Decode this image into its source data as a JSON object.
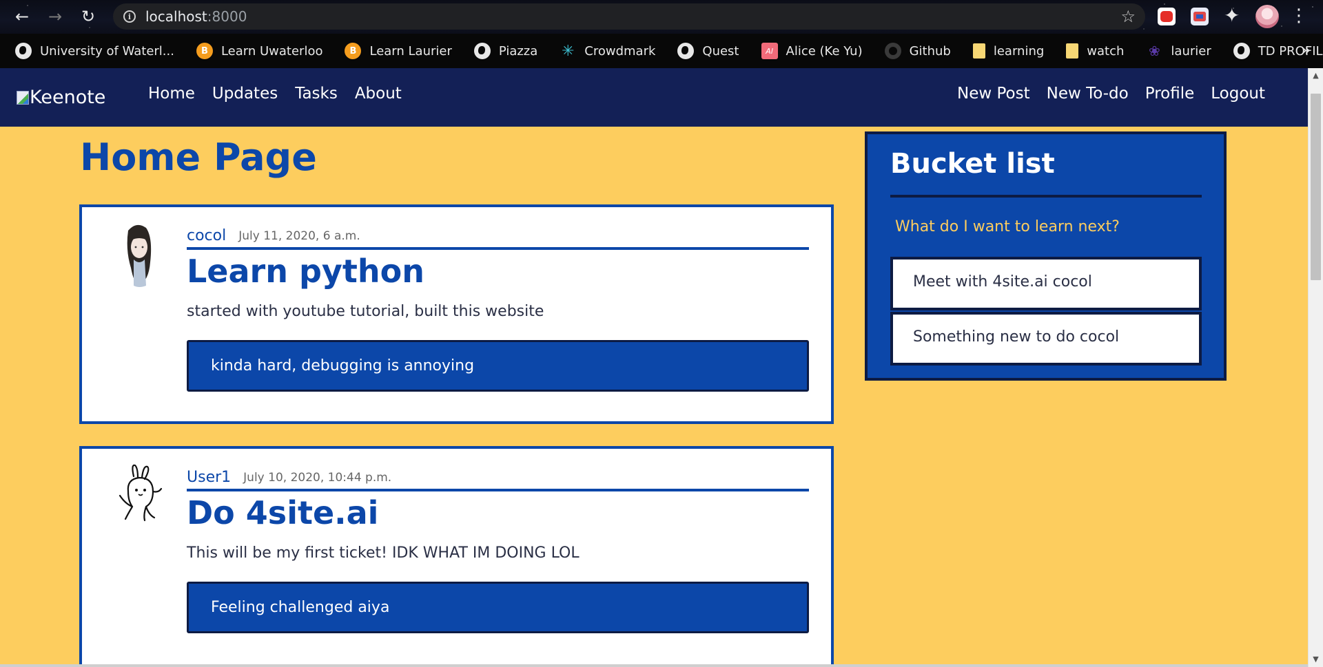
{
  "browser": {
    "url_host": "localhost",
    "url_port": ":8000",
    "bookmarks": [
      {
        "label": "University of Waterl...",
        "icon": "globe-icon"
      },
      {
        "label": "Learn Uwaterloo",
        "icon": "d2l-icon"
      },
      {
        "label": "Learn Laurier",
        "icon": "d2l-icon"
      },
      {
        "label": "Piazza",
        "icon": "globe-icon"
      },
      {
        "label": "Crowdmark",
        "icon": "crowdmark-icon"
      },
      {
        "label": "Quest",
        "icon": "globe-icon"
      },
      {
        "label": "Alice (Ke Yu)",
        "icon": "alice-icon"
      },
      {
        "label": "Github",
        "icon": "github-icon"
      },
      {
        "label": "learning",
        "icon": "folder-icon"
      },
      {
        "label": "watch",
        "icon": "folder-icon"
      },
      {
        "label": "laurier",
        "icon": "maple-leaf-icon"
      },
      {
        "label": "TD PROFILE",
        "icon": "globe-icon"
      }
    ]
  },
  "site": {
    "brand": "Keenote",
    "nav_left": [
      "Home",
      "Updates",
      "Tasks",
      "About"
    ],
    "nav_right": [
      "New Post",
      "New To-do",
      "Profile",
      "Logout"
    ]
  },
  "page": {
    "title": "Home Page"
  },
  "posts": [
    {
      "author": "cocol",
      "date": "July 11, 2020, 6 a.m.",
      "title": "Learn python",
      "body": "started with youtube tutorial, built this website",
      "comment": "kinda hard, debugging is annoying"
    },
    {
      "author": "User1",
      "date": "July 10, 2020, 10:44 p.m.",
      "title": "Do 4site.ai",
      "body": "This will be my first ticket! IDK WHAT IM DOING LOL",
      "comment": "Feeling challenged aiya"
    }
  ],
  "bucket_list": {
    "title": "Bucket list",
    "question": "What do I want to learn next?",
    "items": [
      "Meet with 4site.ai cocol",
      "Something new to do cocol"
    ]
  },
  "colors": {
    "navbar": "#132056",
    "page_background": "#fdcd5e",
    "accent_blue": "#0c47a9",
    "dark_border": "#0d1b43"
  }
}
